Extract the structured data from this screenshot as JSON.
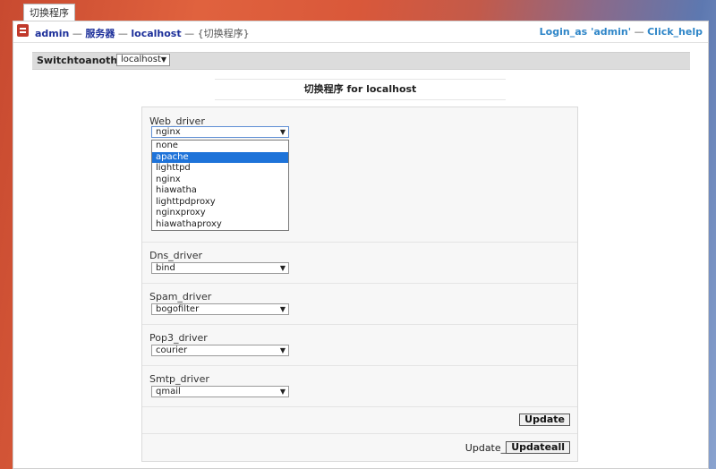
{
  "tab": {
    "label": "切换程序"
  },
  "breadcrumb": {
    "admin": "admin",
    "sep1": " — ",
    "servers": "服务器",
    "sep2": " — ",
    "host": "localhost",
    "sep3": " — ",
    "current": "{切换程序}"
  },
  "toplinks": {
    "login_as": "Login_as 'admin'",
    "sep": " — ",
    "help": "Click_help"
  },
  "switchbar": {
    "label": "Switchtoanother",
    "value": "localhost"
  },
  "page_title": "切换程序 for localhost",
  "form": {
    "web_driver": {
      "label": "Web_driver",
      "value": "nginx"
    },
    "dns_driver": {
      "label": "Dns_driver",
      "value": "bind"
    },
    "spam_driver": {
      "label": "Spam_driver",
      "value": "bogofilter"
    },
    "pop3_driver": {
      "label": "Pop3_driver",
      "value": "courier"
    },
    "smtp_driver": {
      "label": "Smtp_driver",
      "value": "qmail"
    },
    "update_button": "Update",
    "update_all_label": "Update_all",
    "update_all_button": "Updateall"
  },
  "dropdown": {
    "options": [
      "none",
      "apache",
      "lighttpd",
      "nginx",
      "hiawatha",
      "lighttpdproxy",
      "nginxproxy",
      "hiawathaproxy"
    ],
    "highlighted": "apache"
  },
  "colors": {
    "link": "#1c2f9a",
    "help_link": "#2f86c8",
    "highlight": "#1e73d9",
    "icon": "#c0392b"
  }
}
